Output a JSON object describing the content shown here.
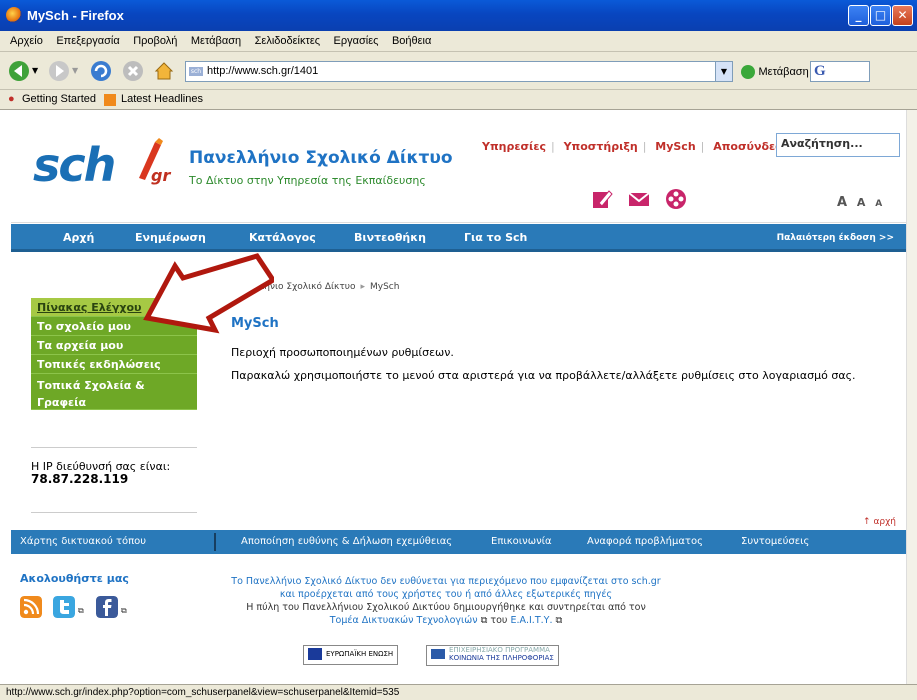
{
  "window": {
    "title": "MySch - Firefox"
  },
  "menu": [
    "Αρχείο",
    "Επεξεργασία",
    "Προβολή",
    "Μετάβαση",
    "Σελιδοδείκτες",
    "Εργασίες",
    "Βοήθεια"
  ],
  "toolbar": {
    "url": "http://www.sch.gr/1401",
    "go_label": "Μετάβαση"
  },
  "bookmarks": [
    "Getting Started",
    "Latest Headlines"
  ],
  "header": {
    "logo": "sch",
    "logo_suffix": "gr",
    "title": "Πανελλήνιο Σχολικό Δίκτυο",
    "subtitle": "Το Δίκτυο στην Υπηρεσία της Εκπαίδευσης",
    "links": [
      "Υπηρεσίες",
      "Υποστήριξη",
      "MySch",
      "Αποσύνδεση"
    ],
    "search_placeholder": "Αναζήτηση...",
    "font_sizes": [
      "A",
      "A",
      "A"
    ]
  },
  "nav": {
    "items": [
      "Αρχή",
      "Ενημέρωση",
      "Κατάλογος",
      "Βιντεοθήκη",
      "Για το Sch"
    ],
    "old_version": "Παλαιότερη έκδοση >>"
  },
  "sidebar": {
    "items": [
      "Πίνακας Ελέγχου",
      "Το σχολείο μου",
      "Τα αρχεία μου",
      "Τοπικές εκδηλώσεις",
      "Τοπικά Σχολεία & Γραφεία"
    ],
    "ip_label": "Η IP διεύθυνσή σας είναι:",
    "ip_value": "78.87.228.119"
  },
  "content": {
    "breadcrumb": [
      "Πανελλήνιο Σχολικό Δίκτυο",
      "MySch"
    ],
    "title": "MySch",
    "p1": "Περιοχή προσωποποιημένων ρυθμίσεων.",
    "p2": "Παρακαλώ χρησιμοποιήστε το μενού στα αριστερά για να προβάλλετε/αλλάξετε ρυθμίσεις στο λογαριασμό σας.",
    "top_link": "↑ αρχή"
  },
  "footer": {
    "links": [
      "Χάρτης δικτυακού τόπου",
      "Αποποίηση ευθύνης & Δήλωση εχεμύθειας",
      "Επικοινωνία",
      "Αναφορά προβλήματος",
      "Συντομεύσεις"
    ],
    "follow": "Ακολουθήστε μας",
    "disclaimer_1": "Το Πανελλήνιο Σχολικό Δίκτυο δεν ευθύνεται για περιεχόμενο που εμφανίζεται στο sch.gr",
    "disclaimer_2": "και προέρχεται από τους χρήστες του ή από άλλες εξωτερικές πηγές",
    "disclaimer_3": "Η πύλη του Πανελλήνιου Σχολικού Δικτύου δημιουργήθηκε και συντηρείται από τον",
    "disclaimer_4a": "Τομέα Δικτυακών Τεχνολογιών",
    "disclaimer_4b": "του",
    "disclaimer_4c": "Ε.Α.Ι.Τ.Υ.",
    "eu_label": "ΕΥΡΩΠΑΪΚΗ ΕΝΩΣΗ",
    "program_label_1": "ΕΠΙΧΕΙΡΗΣΙΑΚΟ ΠΡΟΓΡΑΜΜΑ",
    "program_label_2": "ΚΟΙΝΩΝΙΑ ΤΗΣ ΠΛΗΡΟΦΟΡΙΑΣ"
  },
  "status": "http://www.sch.gr/index.php?option=com_schuserpanel&view=schuserpanel&Itemid=535",
  "colors": {
    "nav_blue": "#2a7ab8",
    "sidebar_green": "#6ea826",
    "link_red": "#c0302a",
    "arrow_red": "#b0180e"
  }
}
